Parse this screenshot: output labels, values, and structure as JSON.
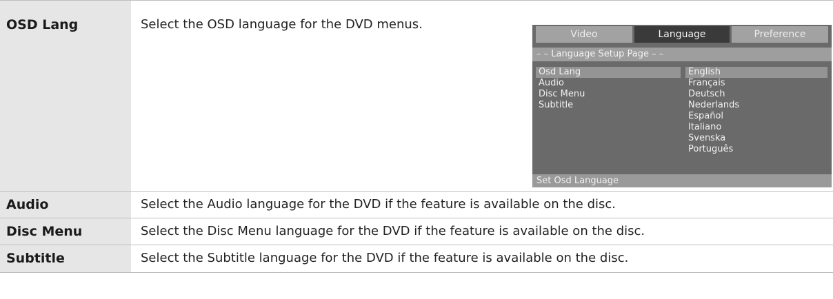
{
  "rows": [
    {
      "label": "OSD Lang",
      "description": "Select the OSD language for the DVD menus."
    },
    {
      "label": "Audio",
      "description": "Select the Audio language for the DVD if the feature is available on the disc."
    },
    {
      "label": "Disc Menu",
      "description": "Select the Disc Menu language for the DVD if the feature is available on the disc."
    },
    {
      "label": "Subtitle",
      "description": "Select the Subtitle language for the DVD if the feature is available on the disc."
    }
  ],
  "osd_menu": {
    "tabs": [
      "Video",
      "Language",
      "Preference"
    ],
    "active_tab": "Language",
    "page_title": "– – Language Setup Page – –",
    "settings": [
      "Osd Lang",
      "Audio",
      "Disc Menu",
      "Subtitle"
    ],
    "languages": [
      "English",
      "Français",
      "Deutsch",
      "Nederlands",
      "Español",
      "Italiano",
      "Svenska",
      "Português"
    ],
    "selected_setting": "Osd Lang",
    "selected_language": "English",
    "footer": "Set Osd Language"
  }
}
